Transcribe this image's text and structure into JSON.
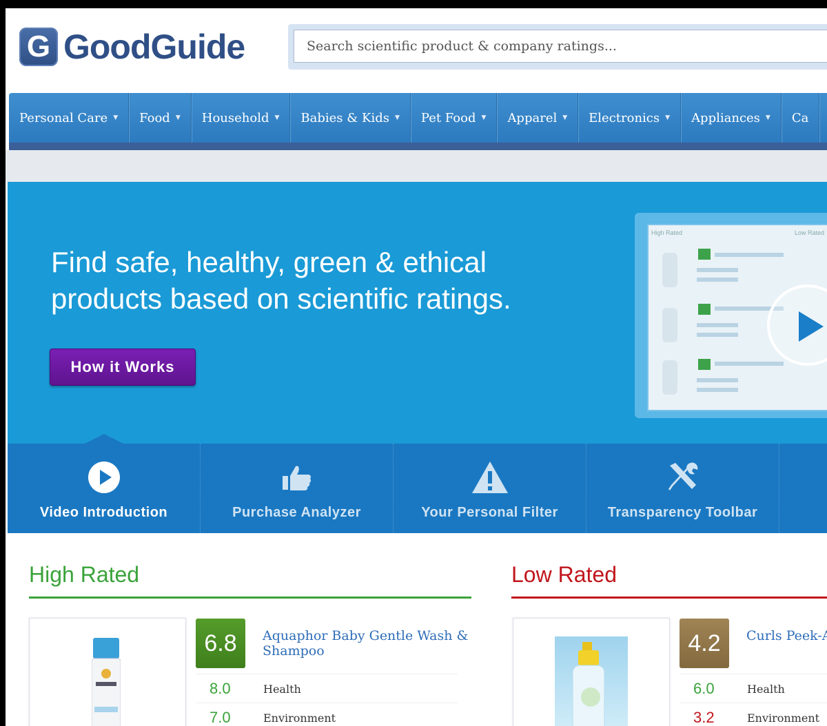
{
  "header": {
    "logo_mark": "G",
    "logo_text": "GoodGuide",
    "search_placeholder": "Search scientific product & company ratings..."
  },
  "nav": {
    "items": [
      {
        "label": "Personal Care"
      },
      {
        "label": "Food"
      },
      {
        "label": "Household"
      },
      {
        "label": "Babies & Kids"
      },
      {
        "label": "Pet Food"
      },
      {
        "label": "Apparel"
      },
      {
        "label": "Electronics"
      },
      {
        "label": "Appliances"
      },
      {
        "label": "Ca"
      }
    ]
  },
  "hero": {
    "headline": "Find safe, healthy, green & ethical products based on scientific ratings.",
    "button_label": "How it Works",
    "video_thumb_high": "High Rated",
    "video_thumb_low": "Low Rated"
  },
  "features": [
    {
      "label": "Video Introduction",
      "icon": "play-circle-icon",
      "active": true
    },
    {
      "label": "Purchase Analyzer",
      "icon": "thumbs-up-icon",
      "active": false
    },
    {
      "label": "Your Personal Filter",
      "icon": "warning-icon",
      "active": false
    },
    {
      "label": "Transparency Toolbar",
      "icon": "tools-icon",
      "active": false
    }
  ],
  "high_rated": {
    "title": "High Rated",
    "color": "#3aa33a",
    "product": {
      "score": "6.8",
      "name": "Aquaphor Baby Gentle Wash & Shampoo",
      "metrics": [
        {
          "value": "8.0",
          "label": "Health"
        },
        {
          "value": "7.0",
          "label": "Environment"
        }
      ]
    }
  },
  "low_rated": {
    "title": "Low Rated",
    "color": "#c0161c",
    "product": {
      "score": "4.2",
      "name": "Curls Peek-A Shampoo",
      "metrics": [
        {
          "value": "6.0",
          "label": "Health"
        },
        {
          "value": "3.2",
          "label": "Environment"
        }
      ]
    }
  }
}
